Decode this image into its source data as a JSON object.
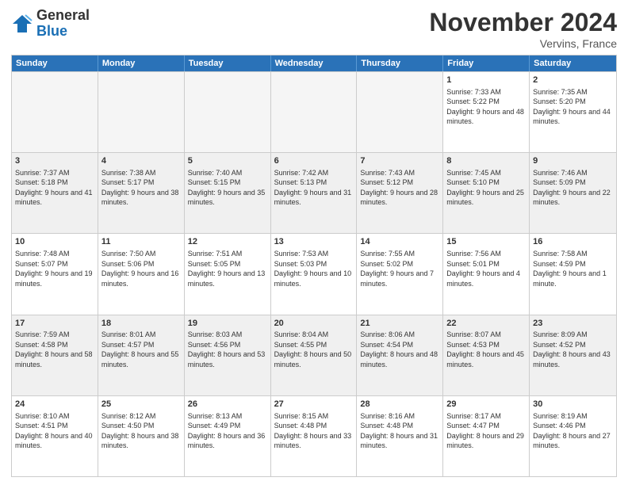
{
  "header": {
    "logo_general": "General",
    "logo_blue": "Blue",
    "month_title": "November 2024",
    "location": "Vervins, France"
  },
  "days_of_week": [
    "Sunday",
    "Monday",
    "Tuesday",
    "Wednesday",
    "Thursday",
    "Friday",
    "Saturday"
  ],
  "rows": [
    [
      {
        "day": "",
        "text": "",
        "empty": true
      },
      {
        "day": "",
        "text": "",
        "empty": true
      },
      {
        "day": "",
        "text": "",
        "empty": true
      },
      {
        "day": "",
        "text": "",
        "empty": true
      },
      {
        "day": "",
        "text": "",
        "empty": true
      },
      {
        "day": "1",
        "text": "Sunrise: 7:33 AM\nSunset: 5:22 PM\nDaylight: 9 hours and 48 minutes.",
        "empty": false
      },
      {
        "day": "2",
        "text": "Sunrise: 7:35 AM\nSunset: 5:20 PM\nDaylight: 9 hours and 44 minutes.",
        "empty": false
      }
    ],
    [
      {
        "day": "3",
        "text": "Sunrise: 7:37 AM\nSunset: 5:18 PM\nDaylight: 9 hours and 41 minutes.",
        "empty": false
      },
      {
        "day": "4",
        "text": "Sunrise: 7:38 AM\nSunset: 5:17 PM\nDaylight: 9 hours and 38 minutes.",
        "empty": false
      },
      {
        "day": "5",
        "text": "Sunrise: 7:40 AM\nSunset: 5:15 PM\nDaylight: 9 hours and 35 minutes.",
        "empty": false
      },
      {
        "day": "6",
        "text": "Sunrise: 7:42 AM\nSunset: 5:13 PM\nDaylight: 9 hours and 31 minutes.",
        "empty": false
      },
      {
        "day": "7",
        "text": "Sunrise: 7:43 AM\nSunset: 5:12 PM\nDaylight: 9 hours and 28 minutes.",
        "empty": false
      },
      {
        "day": "8",
        "text": "Sunrise: 7:45 AM\nSunset: 5:10 PM\nDaylight: 9 hours and 25 minutes.",
        "empty": false
      },
      {
        "day": "9",
        "text": "Sunrise: 7:46 AM\nSunset: 5:09 PM\nDaylight: 9 hours and 22 minutes.",
        "empty": false
      }
    ],
    [
      {
        "day": "10",
        "text": "Sunrise: 7:48 AM\nSunset: 5:07 PM\nDaylight: 9 hours and 19 minutes.",
        "empty": false
      },
      {
        "day": "11",
        "text": "Sunrise: 7:50 AM\nSunset: 5:06 PM\nDaylight: 9 hours and 16 minutes.",
        "empty": false
      },
      {
        "day": "12",
        "text": "Sunrise: 7:51 AM\nSunset: 5:05 PM\nDaylight: 9 hours and 13 minutes.",
        "empty": false
      },
      {
        "day": "13",
        "text": "Sunrise: 7:53 AM\nSunset: 5:03 PM\nDaylight: 9 hours and 10 minutes.",
        "empty": false
      },
      {
        "day": "14",
        "text": "Sunrise: 7:55 AM\nSunset: 5:02 PM\nDaylight: 9 hours and 7 minutes.",
        "empty": false
      },
      {
        "day": "15",
        "text": "Sunrise: 7:56 AM\nSunset: 5:01 PM\nDaylight: 9 hours and 4 minutes.",
        "empty": false
      },
      {
        "day": "16",
        "text": "Sunrise: 7:58 AM\nSunset: 4:59 PM\nDaylight: 9 hours and 1 minute.",
        "empty": false
      }
    ],
    [
      {
        "day": "17",
        "text": "Sunrise: 7:59 AM\nSunset: 4:58 PM\nDaylight: 8 hours and 58 minutes.",
        "empty": false
      },
      {
        "day": "18",
        "text": "Sunrise: 8:01 AM\nSunset: 4:57 PM\nDaylight: 8 hours and 55 minutes.",
        "empty": false
      },
      {
        "day": "19",
        "text": "Sunrise: 8:03 AM\nSunset: 4:56 PM\nDaylight: 8 hours and 53 minutes.",
        "empty": false
      },
      {
        "day": "20",
        "text": "Sunrise: 8:04 AM\nSunset: 4:55 PM\nDaylight: 8 hours and 50 minutes.",
        "empty": false
      },
      {
        "day": "21",
        "text": "Sunrise: 8:06 AM\nSunset: 4:54 PM\nDaylight: 8 hours and 48 minutes.",
        "empty": false
      },
      {
        "day": "22",
        "text": "Sunrise: 8:07 AM\nSunset: 4:53 PM\nDaylight: 8 hours and 45 minutes.",
        "empty": false
      },
      {
        "day": "23",
        "text": "Sunrise: 8:09 AM\nSunset: 4:52 PM\nDaylight: 8 hours and 43 minutes.",
        "empty": false
      }
    ],
    [
      {
        "day": "24",
        "text": "Sunrise: 8:10 AM\nSunset: 4:51 PM\nDaylight: 8 hours and 40 minutes.",
        "empty": false
      },
      {
        "day": "25",
        "text": "Sunrise: 8:12 AM\nSunset: 4:50 PM\nDaylight: 8 hours and 38 minutes.",
        "empty": false
      },
      {
        "day": "26",
        "text": "Sunrise: 8:13 AM\nSunset: 4:49 PM\nDaylight: 8 hours and 36 minutes.",
        "empty": false
      },
      {
        "day": "27",
        "text": "Sunrise: 8:15 AM\nSunset: 4:48 PM\nDaylight: 8 hours and 33 minutes.",
        "empty": false
      },
      {
        "day": "28",
        "text": "Sunrise: 8:16 AM\nSunset: 4:48 PM\nDaylight: 8 hours and 31 minutes.",
        "empty": false
      },
      {
        "day": "29",
        "text": "Sunrise: 8:17 AM\nSunset: 4:47 PM\nDaylight: 8 hours and 29 minutes.",
        "empty": false
      },
      {
        "day": "30",
        "text": "Sunrise: 8:19 AM\nSunset: 4:46 PM\nDaylight: 8 hours and 27 minutes.",
        "empty": false
      }
    ]
  ]
}
